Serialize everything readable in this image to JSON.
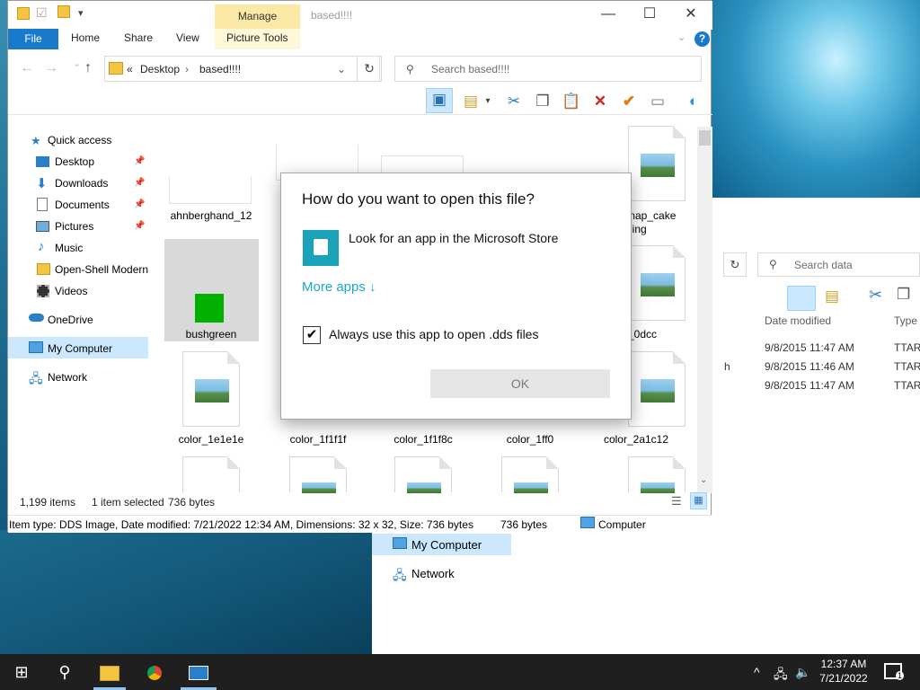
{
  "window": {
    "title": "based!!!!",
    "manage_tab": "Manage",
    "tabs": [
      "File",
      "Home",
      "Share",
      "View",
      "Picture Tools"
    ],
    "address": {
      "prefix": "«",
      "crumbs": [
        "Desktop",
        "based!!!!"
      ]
    },
    "search_placeholder": "Search based!!!!"
  },
  "nav": {
    "items": [
      {
        "label": "Quick access",
        "icon": "star-icon"
      },
      {
        "label": "Desktop",
        "icon": "desktop-icon",
        "pinned": true
      },
      {
        "label": "Downloads",
        "icon": "download-icon",
        "pinned": true
      },
      {
        "label": "Documents",
        "icon": "documents-icon",
        "pinned": true
      },
      {
        "label": "Pictures",
        "icon": "pictures-icon",
        "pinned": true
      },
      {
        "label": "Music",
        "icon": "music-icon"
      },
      {
        "label": "Open-Shell Modern",
        "icon": "folder-icon"
      },
      {
        "label": "Videos",
        "icon": "videos-icon"
      },
      {
        "label": "OneDrive",
        "icon": "cloud-icon"
      },
      {
        "label": "My Computer",
        "icon": "computer-icon",
        "selected": true
      },
      {
        "label": "Network",
        "icon": "network-icon"
      }
    ]
  },
  "files": {
    "row1": [
      "ahnberghand_12",
      "",
      "",
      "map_cake\nding"
    ],
    "row2_selected": "bushgreen",
    "row2_partial": "_0dcc",
    "row3": [
      "color_1e1e1e",
      "color_1f1f1f",
      "color_1f1f8c",
      "color_1ff0",
      "color_2a1c12"
    ]
  },
  "status": {
    "items": "1,199 items",
    "selected": "1 item selected",
    "size": "736 bytes",
    "details": "Item type: DDS Image, Date modified: 7/21/2022 12:34 AM, Dimensions: 32 x 32, Size: 736 bytes",
    "size2": "736 bytes",
    "location": "Computer"
  },
  "dialog": {
    "title": "How do you want to open this file?",
    "store_option": "Look for an app in the Microsoft Store",
    "more_apps": "More apps ↓",
    "always_label": "Always use this app to open .dds files",
    "always_checked": true,
    "ok": "OK"
  },
  "back_window": {
    "search_placeholder": "Search data",
    "columns": [
      "Date modified",
      "Type"
    ],
    "rows": [
      {
        "date": "9/8/2015 11:47 AM",
        "type": "TTARC"
      },
      {
        "date": "9/8/2015 11:46 AM",
        "type": "TTARC",
        "name_tail": "h"
      },
      {
        "date": "9/8/2015 11:47 AM",
        "type": "TTARC"
      }
    ],
    "nav": [
      "My Computer",
      "Network"
    ]
  },
  "taskbar": {
    "time": "12:37 AM",
    "date": "7/21/2022",
    "notification_count": "1"
  },
  "colors": {
    "accent": "#1979ca",
    "selection": "#cce8ff",
    "store": "#1aa3b8",
    "link": "#1ea8c8"
  }
}
